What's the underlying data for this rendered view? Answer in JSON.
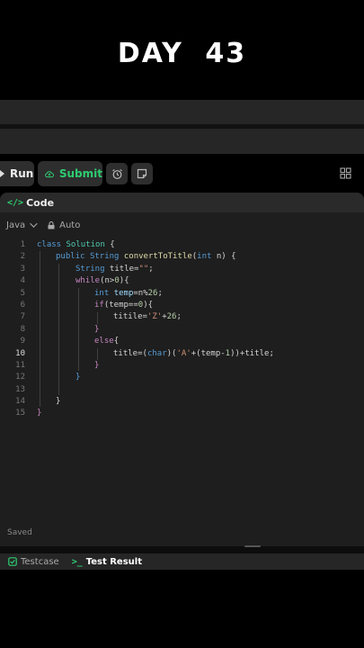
{
  "header": {
    "day_title": "DAY 43"
  },
  "toolbar": {
    "run_label": "Run",
    "submit_label": "Submit"
  },
  "code_panel": {
    "title": "Code",
    "language": "Java",
    "mode": "Auto",
    "status": "Saved",
    "active_line": 10,
    "lines": [
      {
        "n": "1"
      },
      {
        "n": "2"
      },
      {
        "n": "3"
      },
      {
        "n": "4"
      },
      {
        "n": "5"
      },
      {
        "n": "6"
      },
      {
        "n": "7"
      },
      {
        "n": "8"
      },
      {
        "n": "9"
      },
      {
        "n": "10"
      },
      {
        "n": "11"
      },
      {
        "n": "12"
      },
      {
        "n": "13"
      },
      {
        "n": "14"
      },
      {
        "n": "15"
      }
    ],
    "tokens": {
      "l1": [
        "class",
        " ",
        "Solution",
        " {"
      ],
      "l2": [
        "public",
        " ",
        "String",
        " ",
        "convertToTitle",
        "(",
        "int",
        " n) {"
      ],
      "l3": [
        "String",
        " title=",
        "\"\"",
        ";"
      ],
      "l4": [
        "while",
        "(n>",
        "0",
        "){"
      ],
      "l5": [
        "int",
        " ",
        "temp",
        "=n%",
        "26",
        ";"
      ],
      "l6": [
        "if",
        "(temp==",
        "0",
        "){"
      ],
      "l7": [
        "titile",
        "=",
        "'Z'",
        "+",
        "26",
        ";"
      ],
      "l8": [
        "}"
      ],
      "l9": [
        "else",
        "{"
      ],
      "l10": [
        "title",
        "=(",
        "char",
        ")(",
        "'A'",
        "+(temp-",
        "1",
        "))+title;"
      ],
      "l11": [
        "}"
      ],
      "l12": [
        "}"
      ],
      "l13": [
        ""
      ],
      "l14": [
        "}"
      ],
      "l15": [
        "}"
      ]
    }
  },
  "bottom_tabs": {
    "testcase_label": "Testcase",
    "result_label": "Test Result"
  },
  "colors": {
    "accent_green": "#2ecc71",
    "keyword_blue": "#569cd6",
    "string_orange": "#ce9178"
  }
}
